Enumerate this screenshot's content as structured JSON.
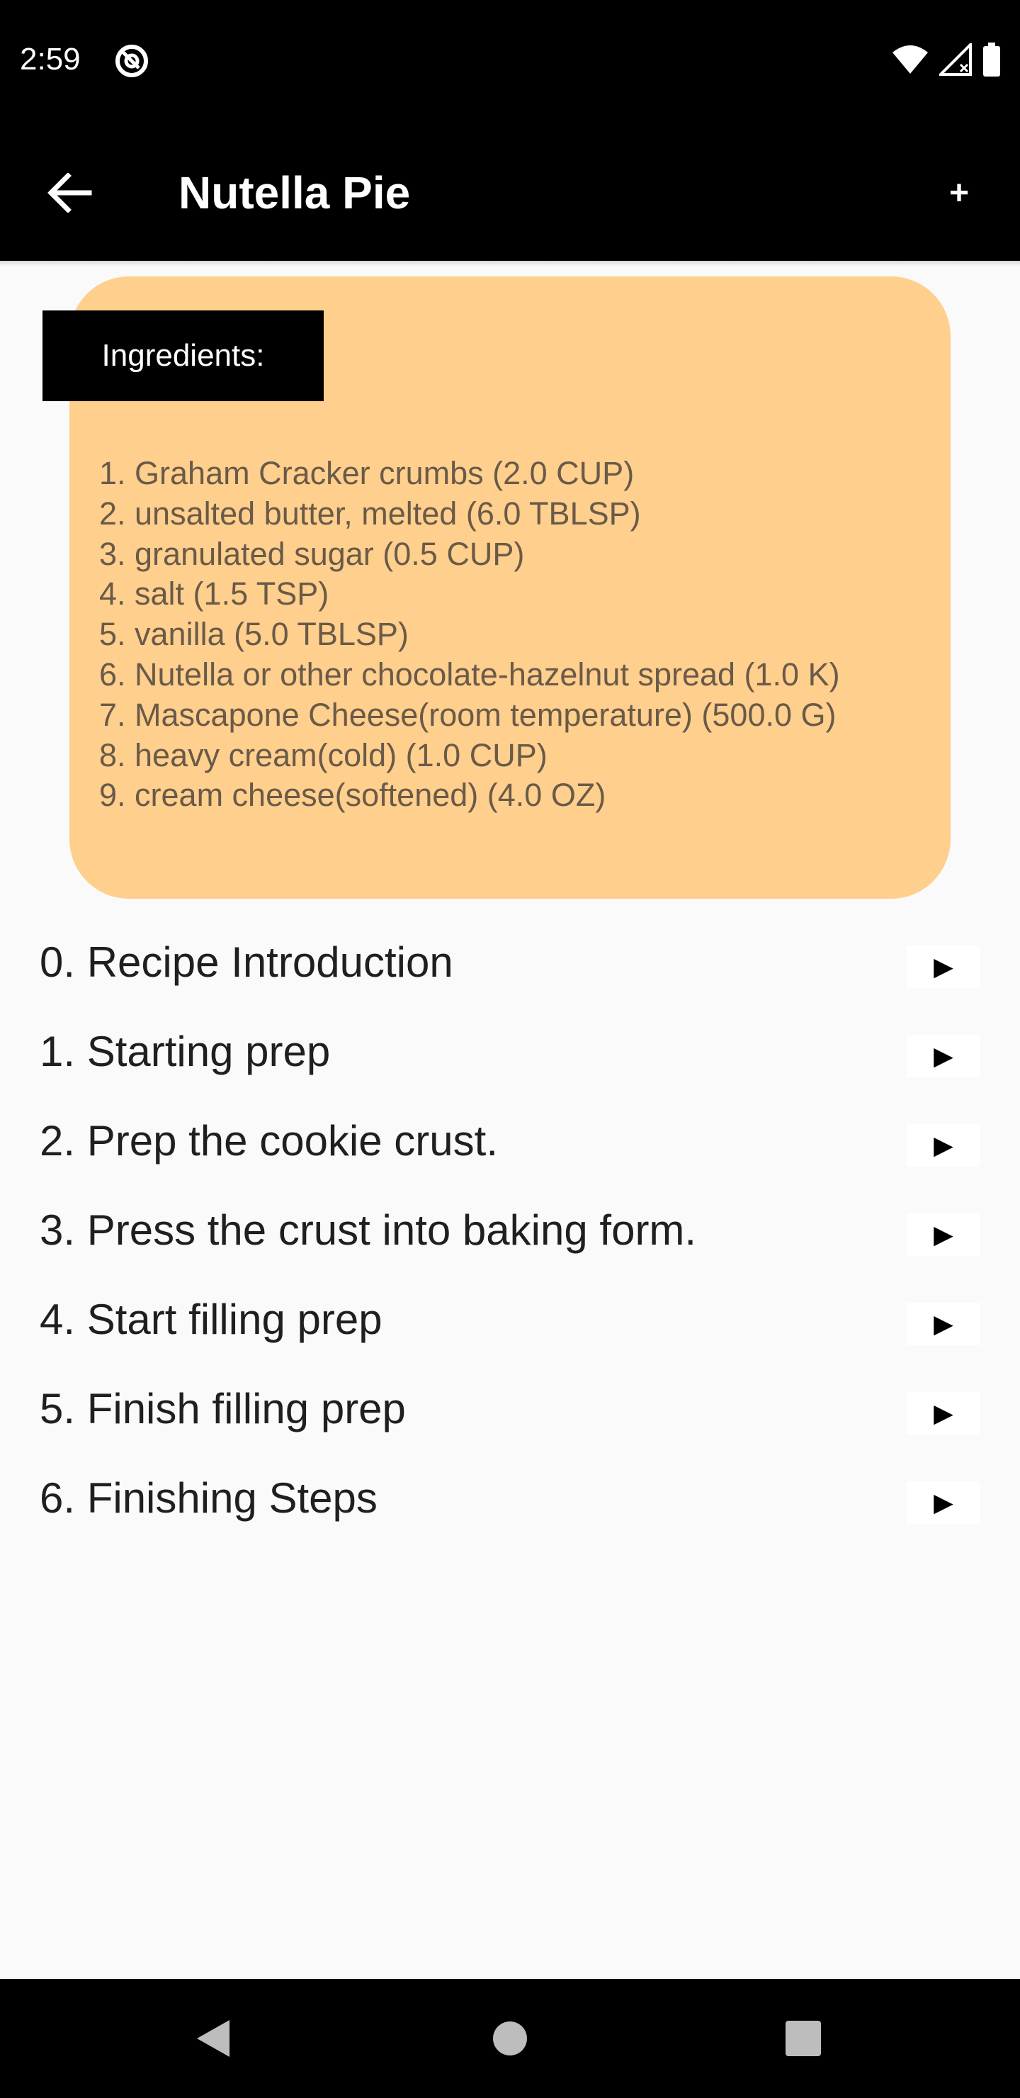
{
  "status_bar": {
    "time": "2:59",
    "icons": [
      "app-notification-icon",
      "wifi-icon",
      "signal-icon",
      "battery-icon"
    ]
  },
  "app_bar": {
    "title": "Nutella Pie",
    "back_icon": "arrow-left-icon",
    "add_label": "+"
  },
  "ingredients": {
    "header": "Ingredients:",
    "items": [
      "1. Graham Cracker crumbs (2.0 CUP)",
      "2. unsalted butter, melted (6.0 TBLSP)",
      "3. granulated sugar (0.5 CUP)",
      "4. salt (1.5 TSP)",
      "5. vanilla (5.0 TBLSP)",
      "6. Nutella or other chocolate-hazelnut spread (1.0 K)",
      "7. Mascapone Cheese(room temperature) (500.0 G)",
      "8. heavy cream(cold) (1.0 CUP)",
      "9. cream cheese(softened) (4.0 OZ)"
    ]
  },
  "steps": [
    {
      "label": "0. Recipe Introduction",
      "play": "▶"
    },
    {
      "label": "1. Starting prep",
      "play": "▶"
    },
    {
      "label": "2. Prep the cookie crust.",
      "play": "▶"
    },
    {
      "label": "3. Press the crust into baking form.",
      "play": "▶"
    },
    {
      "label": "4. Start filling prep",
      "play": "▶"
    },
    {
      "label": "5. Finish filling prep",
      "play": "▶"
    },
    {
      "label": "6. Finishing Steps",
      "play": "▶"
    }
  ],
  "colors": {
    "card_background": "#ffcf8d",
    "bar_background": "#000000",
    "page_background": "#fafafa"
  }
}
